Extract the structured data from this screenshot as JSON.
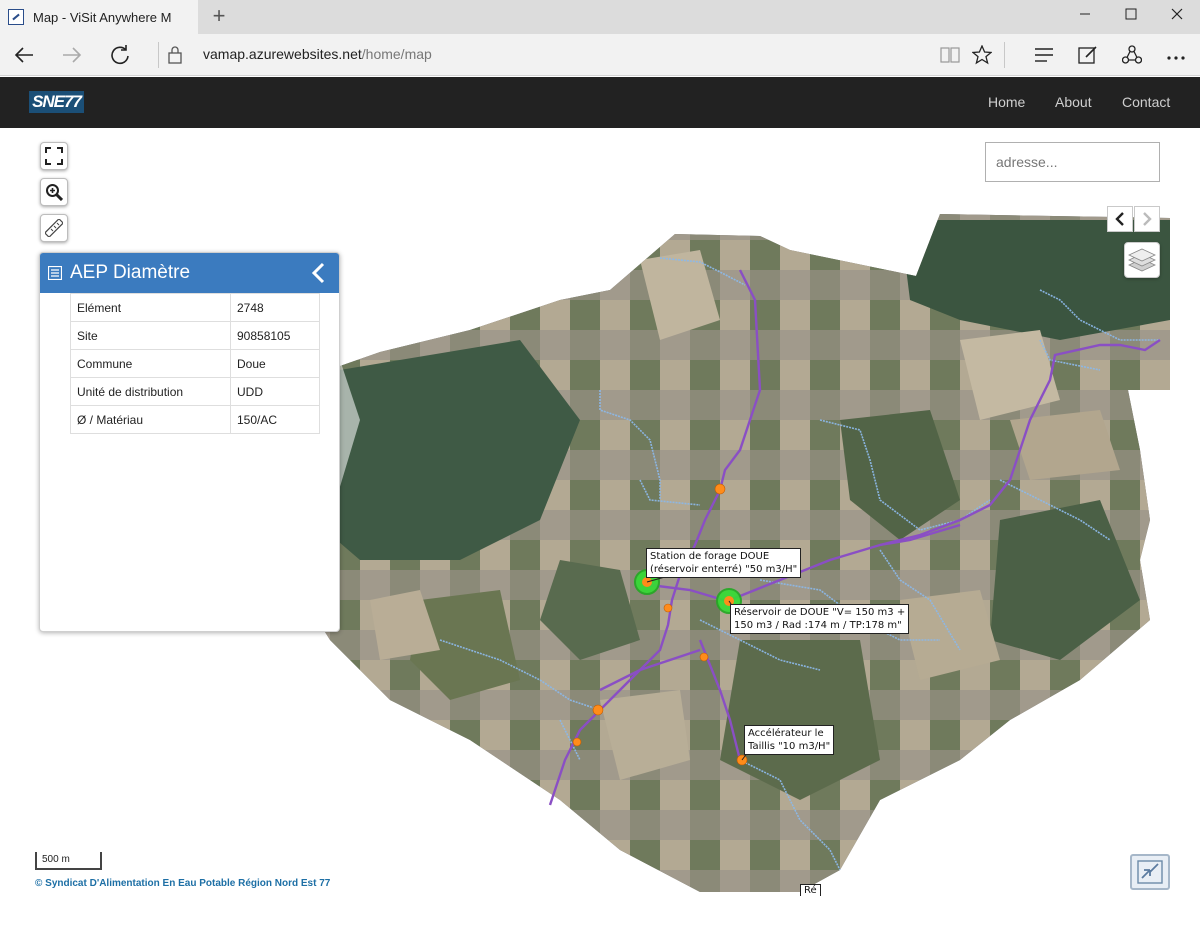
{
  "browser": {
    "tab_title": "Map - ViSit Anywhere M",
    "url_host": "vamap.azurewebsites.net",
    "url_path": "/home/map",
    "new_tab_label": "+",
    "window_controls": [
      "minimize",
      "maximize",
      "close"
    ]
  },
  "site": {
    "logo_text": "SNE77",
    "nav": [
      "Home",
      "About",
      "Contact"
    ]
  },
  "map_controls": {
    "fullscreen_icon": "fullscreen-icon",
    "zoom_icon": "zoom-in-icon",
    "measure_icon": "ruler-icon",
    "layers_icon": "layers-icon"
  },
  "search": {
    "placeholder": "adresse..."
  },
  "panel": {
    "title": "AEP Diamètre",
    "rows": [
      {
        "key": "Elément",
        "value": "2748"
      },
      {
        "key": "Site",
        "value": "90858105"
      },
      {
        "key": "Commune",
        "value": "Doue"
      },
      {
        "key": "Unité de distribution",
        "value": "UDD"
      },
      {
        "key": "Ø / Matériau",
        "value": "150/AC"
      }
    ]
  },
  "map_labels": {
    "station": "Station de forage DOUE\n(réservoir enterré) \"50 m3/H\"",
    "reservoir": "Réservoir de DOUE \"V= 150 m3 +\n150 m3 / Rad :174 m / TP:178 m\"",
    "accelerateur": "Accélérateur le\nTaillis \"10 m3/H\"",
    "partial": "Ré"
  },
  "scale_label": "500 m",
  "attribution": "© Syndicat D'Alimentation En Eau Potable Région Nord Est 77",
  "colors": {
    "nav_bg": "#222222",
    "panel_header": "#3b7bbf",
    "pipe_main": "#8a4fc4",
    "pipe_secondary": "#7fb0e0",
    "node": "#ff8c1a",
    "site_marker": "#33dd33",
    "attribution": "#1d6fa5"
  }
}
